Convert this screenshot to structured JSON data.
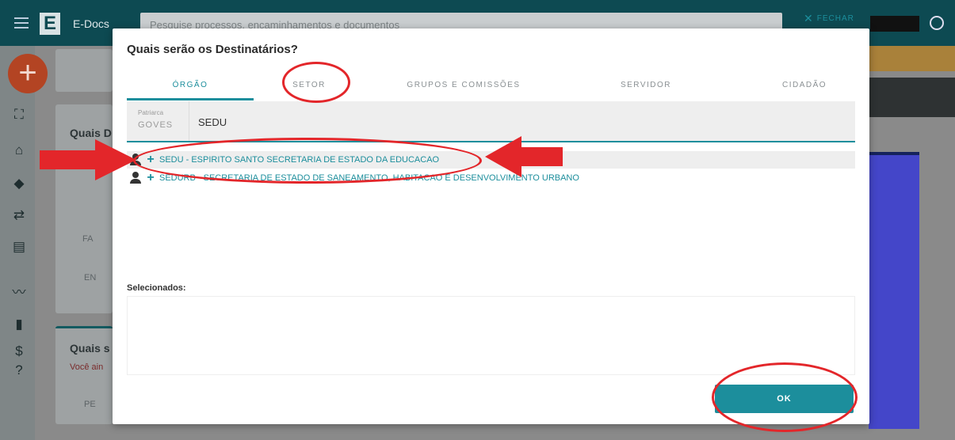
{
  "app": {
    "name": "E-Docs",
    "logo_letter": "E",
    "search_placeholder": "Pesquise processos, encaminhamentos e documentos"
  },
  "background": {
    "card1_button": "☰",
    "card2_title": "Quais D",
    "card3_title": "Quais s",
    "card3_subtitle": "Você ain",
    "small_btn1": "FA",
    "small_btn2": "EN",
    "small_btn3": "PE"
  },
  "modal": {
    "title": "Quais serão os Destinatários?",
    "close_label": "FECHAR",
    "tabs": [
      {
        "label": "ÓRGÃO",
        "active": true
      },
      {
        "label": "SETOR",
        "active": false
      },
      {
        "label": "GRUPOS E COMISSÕES",
        "active": false
      },
      {
        "label": "SERVIDOR",
        "active": false
      },
      {
        "label": "CIDADÃO",
        "active": false
      }
    ],
    "filter": {
      "label": "Patriarca",
      "patriarca_value": "GOVES",
      "query": "SEDU"
    },
    "results": [
      {
        "text": "SEDU - ESPIRITO SANTO SECRETARIA DE ESTADO DA EDUCACAO",
        "highlighted": true
      },
      {
        "text": "SEDURB - SECRETARIA DE ESTADO DE SANEAMENTO, HABITACAO E DESENVOLVIMENTO URBANO",
        "highlighted": false
      }
    ],
    "selected_label": "Selecionados:",
    "ok_label": "OK"
  },
  "colors": {
    "accent": "#1c8e9c",
    "annotation": "#e3262a",
    "topbar": "#0d4a52"
  }
}
